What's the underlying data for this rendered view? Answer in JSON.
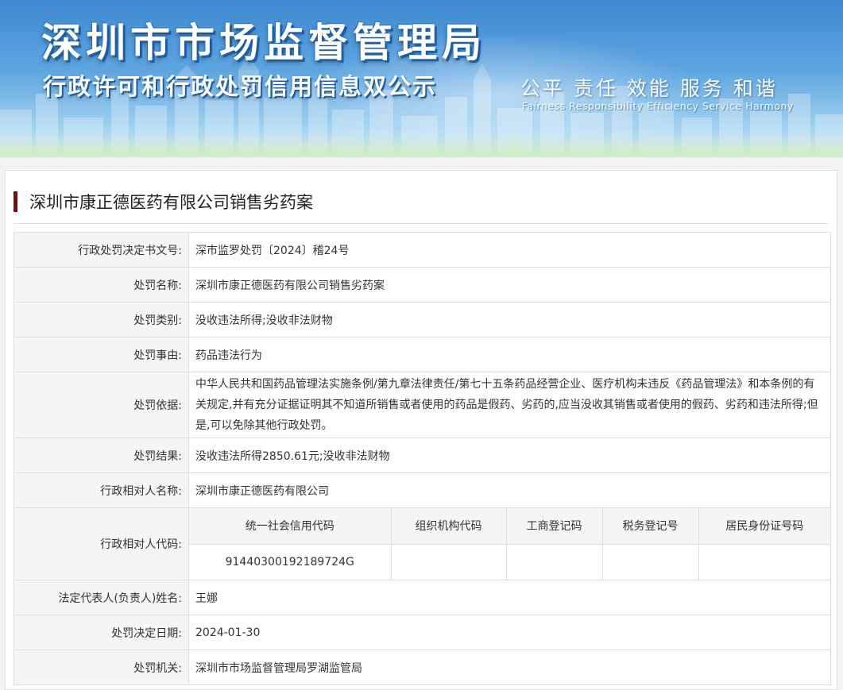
{
  "header": {
    "org_name": "深圳市市场监督管理局",
    "subtitle": "行政许可和行政处罚信用信息双公示",
    "slogan_cn": "公平  责任  效能  服务  和谐",
    "slogan_en": "Fairness  Responsibility  Efficiency  Service  Harmony"
  },
  "case": {
    "title": "深圳市康正德医药有限公司销售劣药案",
    "accent_color": "#7a0c0c"
  },
  "fields": {
    "doc_number": {
      "label": "行政处罚决定书文号:",
      "value": "深市监罗处罚〔2024〕稽24号"
    },
    "penalty_name": {
      "label": "处罚名称:",
      "value": "深圳市康正德医药有限公司销售劣药案"
    },
    "penalty_type": {
      "label": "处罚类别:",
      "value": "没收违法所得;没收非法财物"
    },
    "penalty_reason": {
      "label": "处罚事由:",
      "value": "药品违法行为"
    },
    "penalty_basis": {
      "label": "处罚依据:",
      "value": "中华人民共和国药品管理法实施条例/第九章法律责任/第七十五条药品经营企业、医疗机构未违反《药品管理法》和本条例的有关规定,并有充分证据证明其不知道所销售或者使用的药品是假药、劣药的,应当没收其销售或者使用的假药、劣药和违法所得;但是,可以免除其他行政处罚。"
    },
    "penalty_result": {
      "label": "处罚结果:",
      "value": "没收违法所得2850.61元;没收非法财物"
    },
    "counterparty_name": {
      "label": "行政相对人名称:",
      "value": "深圳市康正德医药有限公司"
    },
    "counterparty_code": {
      "label": "行政相对人代码:",
      "columns": [
        "统一社会信用代码",
        "组织机构代码",
        "工商登记码",
        "税务登记号",
        "居民身份证号码"
      ],
      "values": [
        "91440300192189724G",
        "",
        "",
        "",
        ""
      ]
    },
    "legal_rep": {
      "label": "法定代表人(负责人)姓名:",
      "value": "王娜"
    },
    "decision_date": {
      "label": "处罚决定日期:",
      "value": "2024-01-30"
    },
    "authority": {
      "label": "处罚机关:",
      "value": "深圳市市场监督管理局罗湖监管局"
    }
  }
}
